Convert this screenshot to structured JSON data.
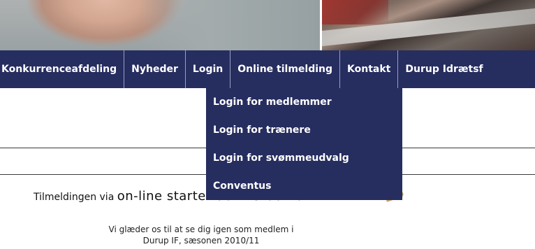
{
  "nav": {
    "items": [
      {
        "label": "Konkurrenceafdeling"
      },
      {
        "label": "Nyheder"
      },
      {
        "label": "Login"
      },
      {
        "label": "Online tilmelding"
      },
      {
        "label": "Kontakt"
      },
      {
        "label": "Durup Idrætsf"
      }
    ]
  },
  "dropdown": {
    "items": [
      {
        "label": "Login for medlemmer"
      },
      {
        "label": "Login for trænere"
      },
      {
        "label": "Login for svømmeudvalg"
      },
      {
        "label": "Conventus"
      }
    ]
  },
  "content": {
    "headline_prefix": "Tilmeldingen via ",
    "headline_big": "on-line starter den 15.08.10",
    "body_line1": "Vi glæder os til at se dig igen som medlem i",
    "body_line2": "Durup IF, sæsonen 2010/11"
  },
  "colors": {
    "nav_background": "#262d5f",
    "nav_text": "#ffffff"
  }
}
